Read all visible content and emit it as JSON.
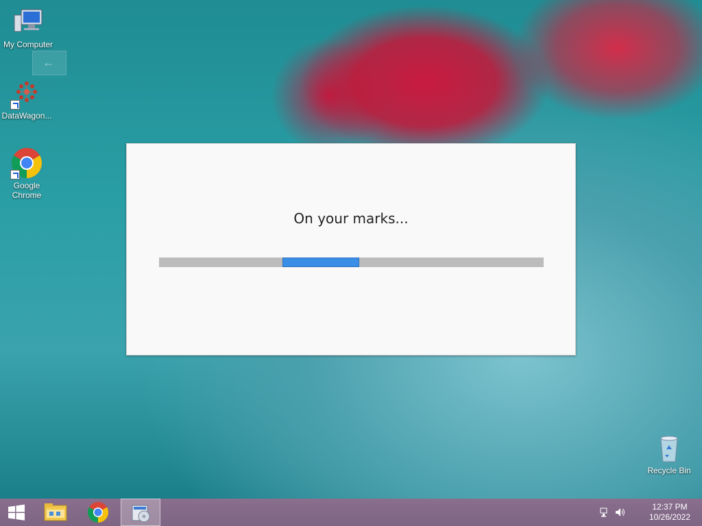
{
  "desktop": {
    "icons": [
      {
        "label": "My Computer",
        "icon": "computer-icon"
      },
      {
        "label": "DataWagon...",
        "icon": "datawagon-icon"
      },
      {
        "label": "Google Chrome",
        "icon": "chrome-icon"
      }
    ],
    "recycle_bin": {
      "label": "Recycle Bin",
      "icon": "recycle-bin-icon"
    }
  },
  "dialog": {
    "title": "On your marks...",
    "progress": {
      "mode": "indeterminate",
      "chunk_start": 0.32,
      "chunk_width": 0.2
    }
  },
  "taskbar": {
    "buttons": [
      {
        "icon": "windows-start-icon"
      },
      {
        "icon": "file-explorer-icon"
      },
      {
        "icon": "chrome-icon"
      },
      {
        "icon": "setup-installer-icon",
        "active": true
      }
    ],
    "tray": {
      "network_icon": "network-icon",
      "volume_icon": "volume-icon",
      "time": "12:37 PM",
      "date": "10/26/2022"
    }
  },
  "colors": {
    "progress_track": "#bcbcbc",
    "progress_chunk": "#3a8ee6",
    "taskbar": "#7d6583",
    "dialog_bg": "#f9f9f9"
  }
}
